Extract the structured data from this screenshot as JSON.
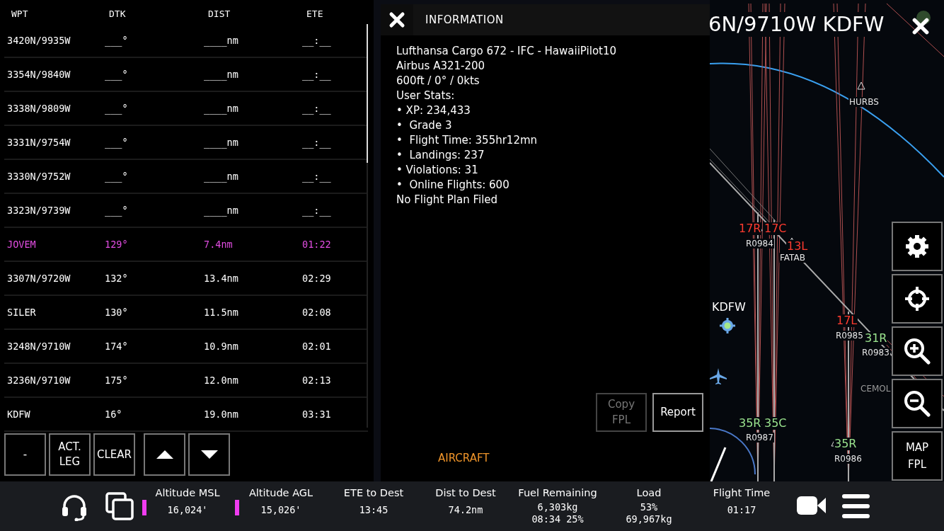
{
  "flight_plan": {
    "columns": [
      "WPT",
      "DTK",
      "DIST",
      "ETE"
    ],
    "rows": [
      {
        "wpt": "3420N/9935W",
        "dtk": "___°",
        "dist": "____nm",
        "ete": "__:__",
        "active": false
      },
      {
        "wpt": "3354N/9840W",
        "dtk": "___°",
        "dist": "____nm",
        "ete": "__:__",
        "active": false
      },
      {
        "wpt": "3338N/9809W",
        "dtk": "___°",
        "dist": "____nm",
        "ete": "__:__",
        "active": false
      },
      {
        "wpt": "3331N/9754W",
        "dtk": "___°",
        "dist": "____nm",
        "ete": "__:__",
        "active": false
      },
      {
        "wpt": "3330N/9752W",
        "dtk": "___°",
        "dist": "____nm",
        "ete": "__:__",
        "active": false
      },
      {
        "wpt": "3323N/9739W",
        "dtk": "___°",
        "dist": "____nm",
        "ete": "__:__",
        "active": false
      },
      {
        "wpt": "JOVEM",
        "dtk": "129°",
        "dist": "7.4nm",
        "ete": "01:22",
        "active": true
      },
      {
        "wpt": "3307N/9720W",
        "dtk": "132°",
        "dist": "13.4nm",
        "ete": "02:29",
        "active": false
      },
      {
        "wpt": "SILER",
        "dtk": "130°",
        "dist": "11.5nm",
        "ete": "02:08",
        "active": false
      },
      {
        "wpt": "3248N/9710W",
        "dtk": "174°",
        "dist": "10.9nm",
        "ete": "02:01",
        "active": false
      },
      {
        "wpt": "3236N/9710W",
        "dtk": "175°",
        "dist": "12.0nm",
        "ete": "02:13",
        "active": false
      },
      {
        "wpt": "KDFW",
        "dtk": "16°",
        "dist": "19.0nm",
        "ete": "03:31",
        "active": false
      }
    ],
    "buttons": [
      {
        "kind": "text",
        "label": "-"
      },
      {
        "kind": "text",
        "label": "ACT.\nLEG"
      },
      {
        "kind": "text",
        "label": "CLEAR"
      },
      {
        "kind": "up"
      },
      {
        "kind": "down"
      }
    ]
  },
  "information": {
    "title": "INFORMATION",
    "lines": [
      "Lufthansa Cargo 672 - IFC - HawaiiPilot10",
      "Airbus A321-200",
      "600ft / 0° / 0kts",
      "User Stats:",
      "• XP: 234,433",
      "•  Grade 3",
      "•  Flight Time: 355hr12mn",
      "•  Landings: 237",
      "• Violations: 31",
      "•  Online Flights: 600",
      "No Flight Plan Filed"
    ],
    "buttons": [
      {
        "label": "Copy\nFPL",
        "disabled": true
      },
      {
        "label": "Report",
        "disabled": false
      }
    ],
    "tab": "AIRCRAFT"
  },
  "map": {
    "title": "6N/9710W KDFW",
    "labels": [
      {
        "text": "HURBS",
        "color": "#e6e6e6"
      },
      {
        "text": "17R",
        "color": "#ff3b2f"
      },
      {
        "text": "17C",
        "color": "#ff3b2f"
      },
      {
        "text": "R0984",
        "color": "#e6e6e6"
      },
      {
        "text": "13L",
        "color": "#ff3b2f"
      },
      {
        "text": "FATAB",
        "color": "#e6e6e6"
      },
      {
        "text": "KDFW",
        "color": "#ffffff"
      },
      {
        "text": "17L",
        "color": "#ff3b2f"
      },
      {
        "text": "R0985",
        "color": "#e6e6e6"
      },
      {
        "text": "31R",
        "color": "#9be58f"
      },
      {
        "text": "R0983",
        "color": "#e6e6e6"
      },
      {
        "text": "CEMOL",
        "color": "#9a9a9a"
      },
      {
        "text": "35R",
        "color": "#9be58f"
      },
      {
        "text": "35C",
        "color": "#9be58f"
      },
      {
        "text": "R0987",
        "color": "#e6e6e6"
      },
      {
        "text": "35R",
        "color": "#9be58f"
      },
      {
        "text": "R0986",
        "color": "#e6e6e6"
      }
    ],
    "tools": [
      {
        "kind": "settings"
      },
      {
        "kind": "locate"
      },
      {
        "kind": "zoom-in"
      },
      {
        "kind": "zoom-out"
      },
      {
        "kind": "text",
        "label": "MAP\nFPL"
      }
    ]
  },
  "status_bar": {
    "stats": [
      {
        "label": "Altitude MSL",
        "values": [
          "16,024'"
        ]
      },
      {
        "label": "Altitude AGL",
        "values": [
          "15,026'"
        ]
      },
      {
        "label": "ETE to Dest",
        "values": [
          "13:45"
        ]
      },
      {
        "label": "Dist to Dest",
        "values": [
          "74.2nm"
        ]
      },
      {
        "label": "Fuel Remaining",
        "values": [
          "6,303kg",
          "08:34 25%"
        ]
      },
      {
        "label": "Load",
        "values": [
          "53%",
          "69,967kg"
        ]
      },
      {
        "label": "Flight Time",
        "values": [
          "01:17"
        ]
      }
    ]
  }
}
